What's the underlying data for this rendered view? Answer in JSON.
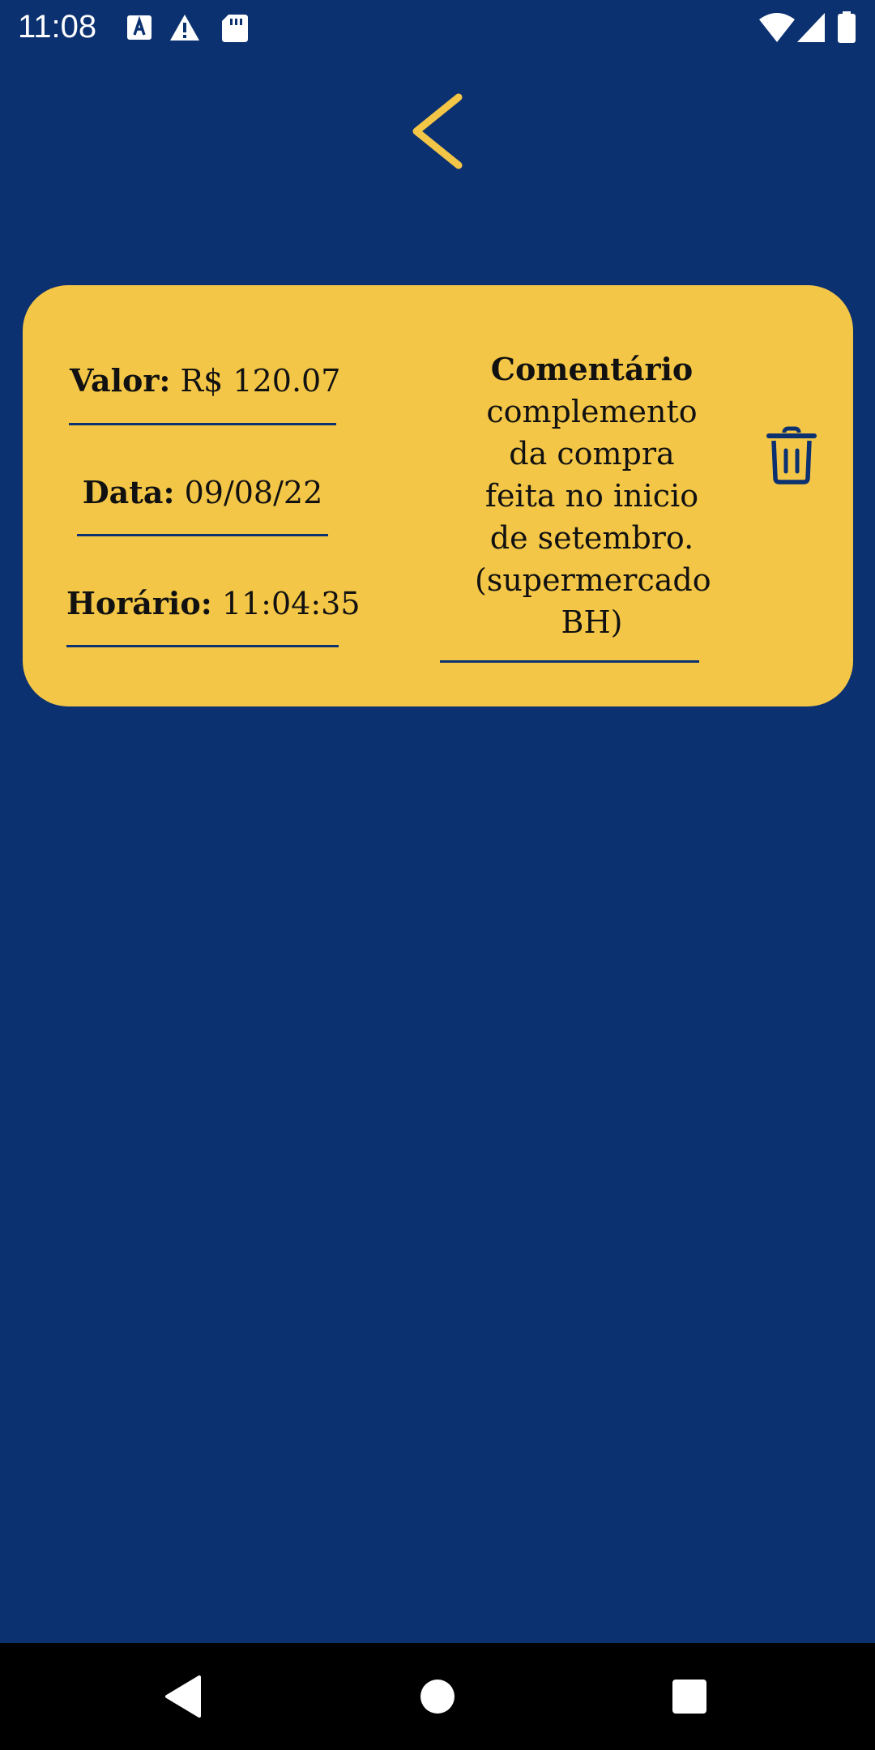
{
  "status_bar": {
    "time": "11:08",
    "left_icons": [
      "keyboard-a-icon",
      "warning-icon",
      "sd-card-icon"
    ],
    "right_icons": [
      "wifi-icon",
      "cell-signal-icon",
      "battery-icon"
    ]
  },
  "header": {
    "back_icon": "chevron-left-icon"
  },
  "record": {
    "valor_label": "Valor:",
    "valor_value": "R$ 120.07",
    "data_label": "Data:",
    "data_value": "09/08/22",
    "horario_label": "Horário:",
    "horario_value": "11:04:35",
    "comentario_label": "Comentário",
    "comentario_text": "complemento da compra feita no inicio de setembro. (supermercado BH)",
    "delete_icon": "trash-icon"
  },
  "nav_bar": {
    "back": "nav-back-icon",
    "home": "nav-home-icon",
    "recents": "nav-recents-icon"
  },
  "colors": {
    "background": "#0b3170",
    "card": "#f3c647",
    "accent": "#f3c647",
    "text": "#111111"
  }
}
